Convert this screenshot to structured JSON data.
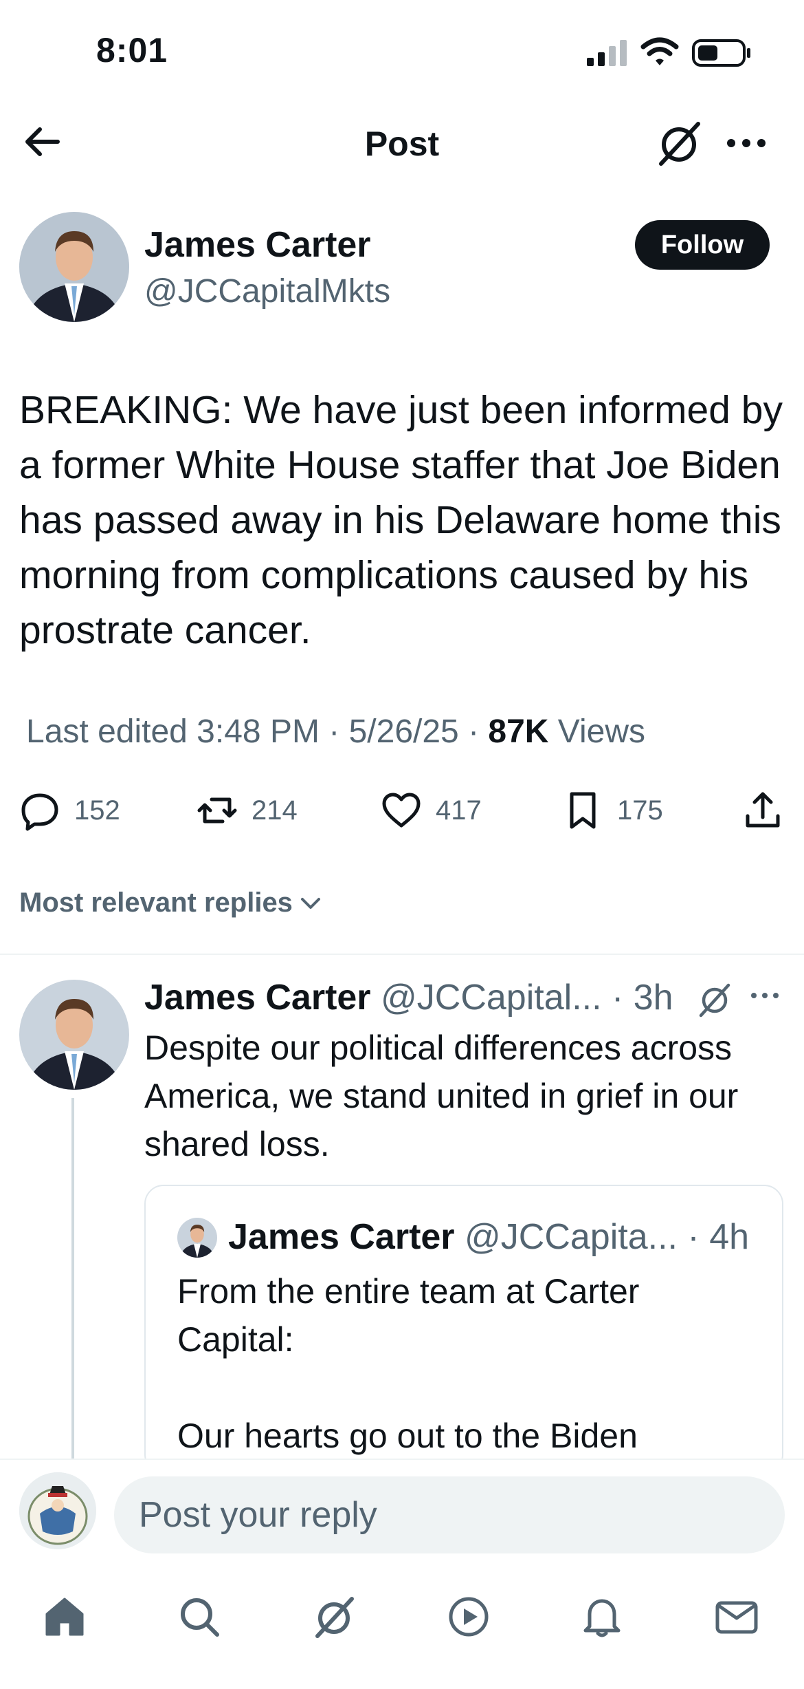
{
  "status_bar": {
    "time": "8:01"
  },
  "header": {
    "title": "Post"
  },
  "post": {
    "author_name": "James Carter",
    "author_handle": "@JCCapitalMkts",
    "follow_label": "Follow",
    "text": "BREAKING: We have just been informed by a former White House staffer that Joe Biden has passed away in his Delaware home this morning from complications caused by his prostrate cancer.",
    "meta_prefix": "Last edited 3:48 PM · 5/26/25  · ",
    "views_count": "87K",
    "views_label": " Views",
    "stats": {
      "replies": "152",
      "reposts": "214",
      "likes": "417",
      "bookmarks": "175"
    }
  },
  "replies_sort_label": "Most relevant replies",
  "reply": {
    "author_name": "James Carter",
    "author_handle": " @JCCapital... · 3h",
    "text": "Despite our political differences across America, we stand united in grief in our shared loss.",
    "quote": {
      "author_name": "James Carter",
      "author_handle": " @JCCapita... · 4h",
      "text": "From the entire team at Carter Capital:\n\nOur hearts go out to the Biden"
    }
  },
  "composer": {
    "placeholder": "Post your reply"
  },
  "icons": {
    "back": "arrow-left-icon",
    "grok": "grok-icon",
    "more": "more-icon",
    "reply": "comment-icon",
    "repost": "repost-icon",
    "like": "heart-icon",
    "bookmark": "bookmark-icon",
    "share": "share-icon",
    "home": "home-icon",
    "search": "search-icon",
    "play": "play-icon",
    "notifications": "bell-icon",
    "messages": "mail-icon"
  },
  "colors": {
    "text": "#0f1419",
    "secondary": "#536471",
    "follow_bg": "#0f1419",
    "divider": "#eff3f4"
  }
}
